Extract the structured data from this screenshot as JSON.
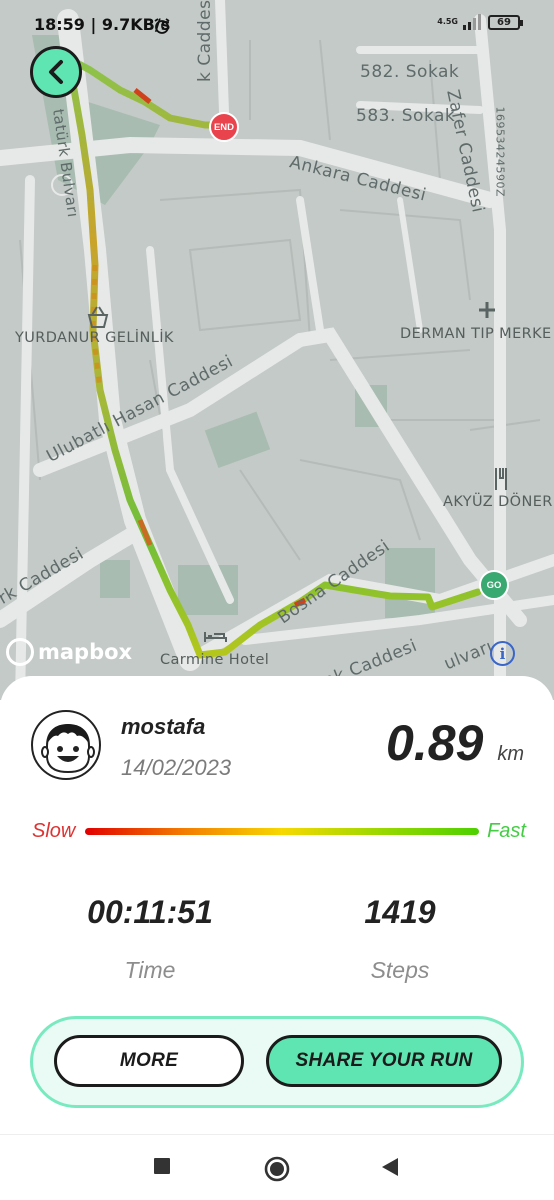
{
  "status_bar": {
    "time_speed": "18:59 | 9.7KB/s",
    "network": "4.5G",
    "battery": "69"
  },
  "map": {
    "streets": {
      "s1": "k Caddesi",
      "s2": "582. Sokak",
      "s3": "583. Sokak",
      "s4": "Zafer Caddesi",
      "s5": "Ankara Caddesi",
      "s6": "Ulubatlı Hasan Caddesi",
      "s7": "tatürk Bulvarı",
      "s8": "rk Caddesi",
      "s9": "Bosna Caddesi",
      "s10": "ak Caddesi",
      "s11": "ulvarı",
      "s12": "16953424590Z"
    },
    "pois": {
      "p1": "YURDANUR GELİNLİK",
      "p2": "DERMAN TIP MERKE",
      "p3": "AKYÜZ DÖNER",
      "p4": "Carmine Hotel"
    },
    "end_label": "END",
    "go_label": "GO",
    "attribution": "mapbox",
    "info": "i"
  },
  "run": {
    "username": "mostafa",
    "date": "14/02/2023",
    "distance": "0.89",
    "distance_unit": "km",
    "legend_slow": "Slow",
    "legend_fast": "Fast",
    "time_value": "00:11:51",
    "time_label": "Time",
    "steps_value": "1419",
    "steps_label": "Steps",
    "more_label": "MORE",
    "share_label": "SHARE YOUR RUN"
  },
  "colors": {
    "accent": "#5ee5b2",
    "end": "#e9434d",
    "go": "#3aa871",
    "slow": "#dd3333",
    "fast": "#44cc44"
  }
}
